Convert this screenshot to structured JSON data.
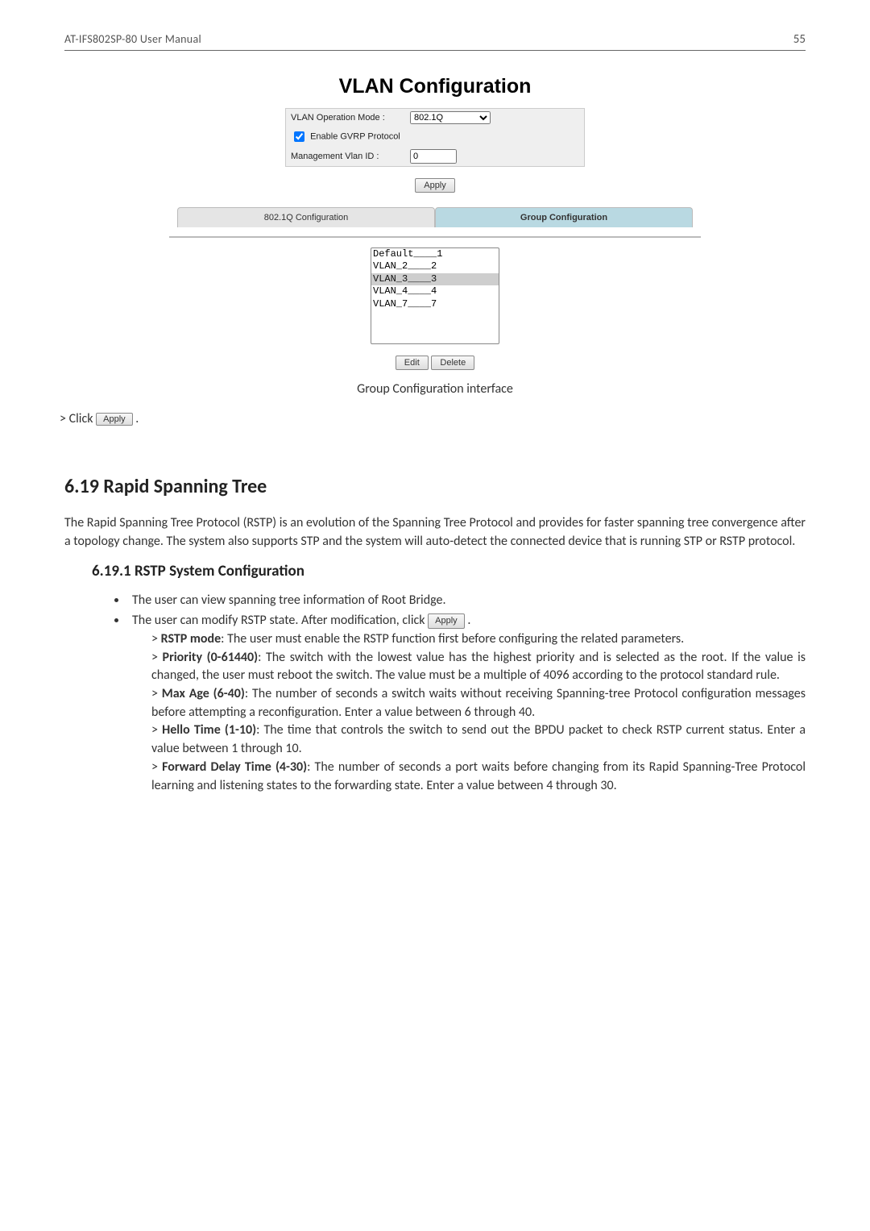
{
  "header": {
    "left": "AT-IFS802SP-80 User Manual",
    "page": "55"
  },
  "screenshot": {
    "title": "VLAN Configuration",
    "operationModeLabel": "VLAN Operation Mode :",
    "operationModeValue": "802.1Q",
    "gvrpLabel": "Enable GVRP Protocol",
    "mgmtVlanLabel": "Management Vlan ID :",
    "mgmtVlanValue": "0",
    "applyLabel": "Apply",
    "tabLeft": "802.1Q Configuration",
    "tabRight": "Group Configuration",
    "vlanOptions": [
      "Default____1",
      "VLAN_2____2",
      "VLAN_3____3",
      "VLAN_4____4",
      "VLAN_7____7"
    ],
    "editLabel": "Edit",
    "deleteLabel": "Delete",
    "caption": "Group Configuration interface"
  },
  "clickLine": {
    "prefix": "> Click",
    "btn": "Apply",
    "suffix": "."
  },
  "section619": {
    "heading": "6.19  Rapid Spanning Tree",
    "para": "The Rapid Spanning Tree Protocol (RSTP) is an evolution of the Spanning Tree Protocol and provides for faster spanning tree convergence after a topology change. The system also supports STP and the system will auto-detect the connected device that is running STP or RSTP protocol."
  },
  "section6191": {
    "heading": "6.19.1  RSTP System Configuration",
    "bullet1": "The user can view spanning tree information of Root Bridge.",
    "bullet2a": "The user can modify RSTP state. After modification, click",
    "bullet2btn": "Apply",
    "bullet2b": ".",
    "items": [
      {
        "label": "RSTP mode",
        "rest": ": The user must enable the RSTP function first before configuring the related parameters."
      },
      {
        "label": "Priority (0-61440)",
        "rest": ": The switch with the lowest value has the highest priority and is selected as the root. If the value is changed, the user must reboot the switch. The value must be a multiple of 4096 according to the protocol standard rule."
      },
      {
        "label": "Max Age (6-40)",
        "rest": ": The number of seconds a switch waits without receiving Spanning-tree Protocol configuration messages before attempting a reconfiguration. Enter a value between 6 through 40."
      },
      {
        "label": "Hello Time (1-10)",
        "rest": ": The time that controls the switch to send out the BPDU packet to check RSTP current status. Enter a value between 1 through 10."
      },
      {
        "label": "Forward Delay Time (4-30)",
        "rest": ": The number of seconds a port waits before changing from its Rapid Spanning-Tree Protocol learning and listening states to the forwarding state. Enter a value between 4 through 30."
      }
    ]
  }
}
